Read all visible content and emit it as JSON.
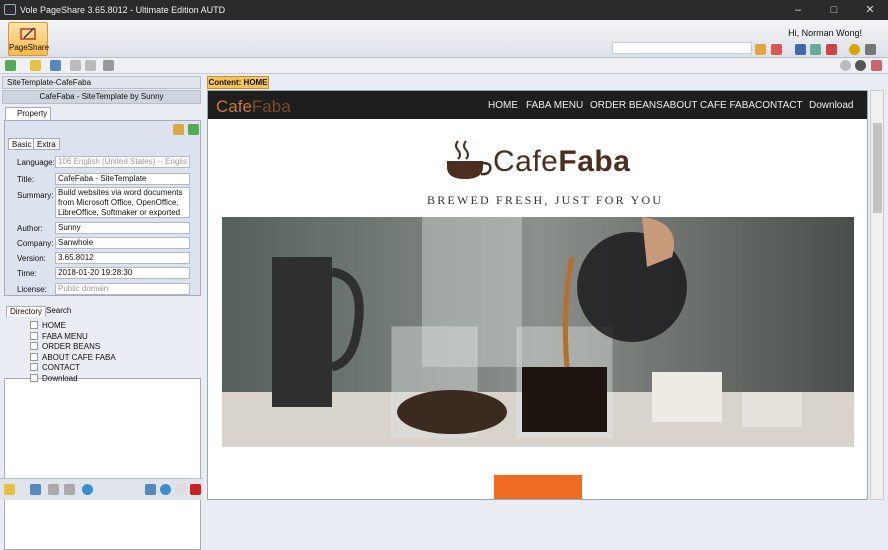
{
  "window": {
    "title": "Vole PageShare  3.65.8012 - Ultimate Edition AUTD"
  },
  "ribbon": {
    "pageshare_label": "PageShare",
    "greeting": "Hi, Norman Wong!"
  },
  "left_panel": {
    "header": "SiteTemplate-CafeFaba",
    "site_title": "CafeFaba - SiteTemplate by Sunny",
    "property_tab": "Property",
    "tabs": [
      "Basic",
      "Extra"
    ],
    "fields": {
      "language_label": "Language:",
      "language_value": "106 English (United States) -- Englis",
      "title_label": "Title:",
      "title_value": "CafeFaba - SiteTemplate",
      "summary_label": "Summary:",
      "summary_value": "Build websites via word documents from Microsoft Office, OpenOffice, LibreOffice, Softmaker or exported",
      "author_label": "Author:",
      "author_value": "Sunny",
      "company_label": "Company:",
      "company_value": "Sanwhole",
      "version_label": "Version:",
      "version_value": "3.65.8012",
      "time_label": "Time:",
      "time_value": "2018-01-20 19:28:30",
      "license_label": "License:",
      "license_value": "Public domain"
    },
    "directory_tabs": [
      "Directory",
      "Search"
    ],
    "directory": [
      "HOME",
      "FABA MENU",
      "ORDER BEANS",
      "ABOUT CAFE FABA",
      "CONTACT",
      "Download"
    ]
  },
  "content": {
    "tab_label": "Content: HOME",
    "brand": {
      "a": "Cafe",
      "b": "Faba"
    },
    "nav": [
      "HOME",
      "FABA MENU",
      "ORDER BEANS",
      "ABOUT CAFE FABA",
      "CONTACT",
      "Download"
    ],
    "logo": {
      "a": "Cafe",
      "b": "Faba"
    },
    "tagline": "BREWED FRESH, JUST FOR YOU"
  },
  "colors": {
    "accent": "#f6c45a",
    "brand": "#4b2e1d",
    "button": "#f06b22"
  }
}
